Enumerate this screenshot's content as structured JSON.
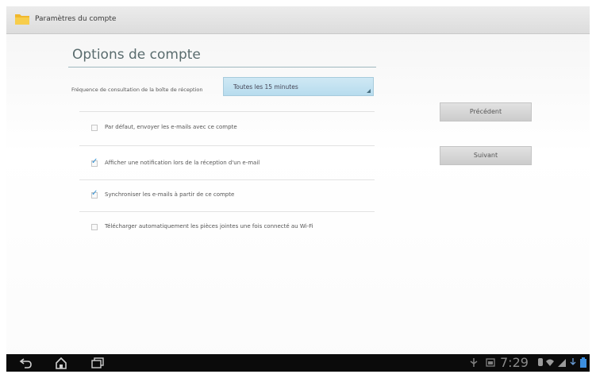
{
  "header": {
    "title": "Paramètres du compte",
    "icon": "folder-icon",
    "icon_color": "#f1b82d"
  },
  "section": {
    "title": "Options de compte",
    "accent": "#9fb8bf"
  },
  "frequency": {
    "label": "Fréquence de consultation de la boîte de réception",
    "value": "Toutes les 15 minutes",
    "select_color": "#b7dcee"
  },
  "options": [
    {
      "label": "Par défaut, envoyer les e-mails avec ce compte",
      "checked": false
    },
    {
      "label": "Afficher une notification lors de la réception d'un e-mail",
      "checked": true
    },
    {
      "label": "Synchroniser les e-mails à partir de ce compte",
      "checked": true
    },
    {
      "label": "Télécharger automatiquement les pièces jointes une fois connecté au Wi-Fi",
      "checked": false
    }
  ],
  "buttons": {
    "previous": "Précédent",
    "next": "Suivant"
  },
  "navbar": {
    "back_icon": "back-icon",
    "home_icon": "home-icon",
    "recent_icon": "recent-apps-icon",
    "clock": "7:29"
  }
}
